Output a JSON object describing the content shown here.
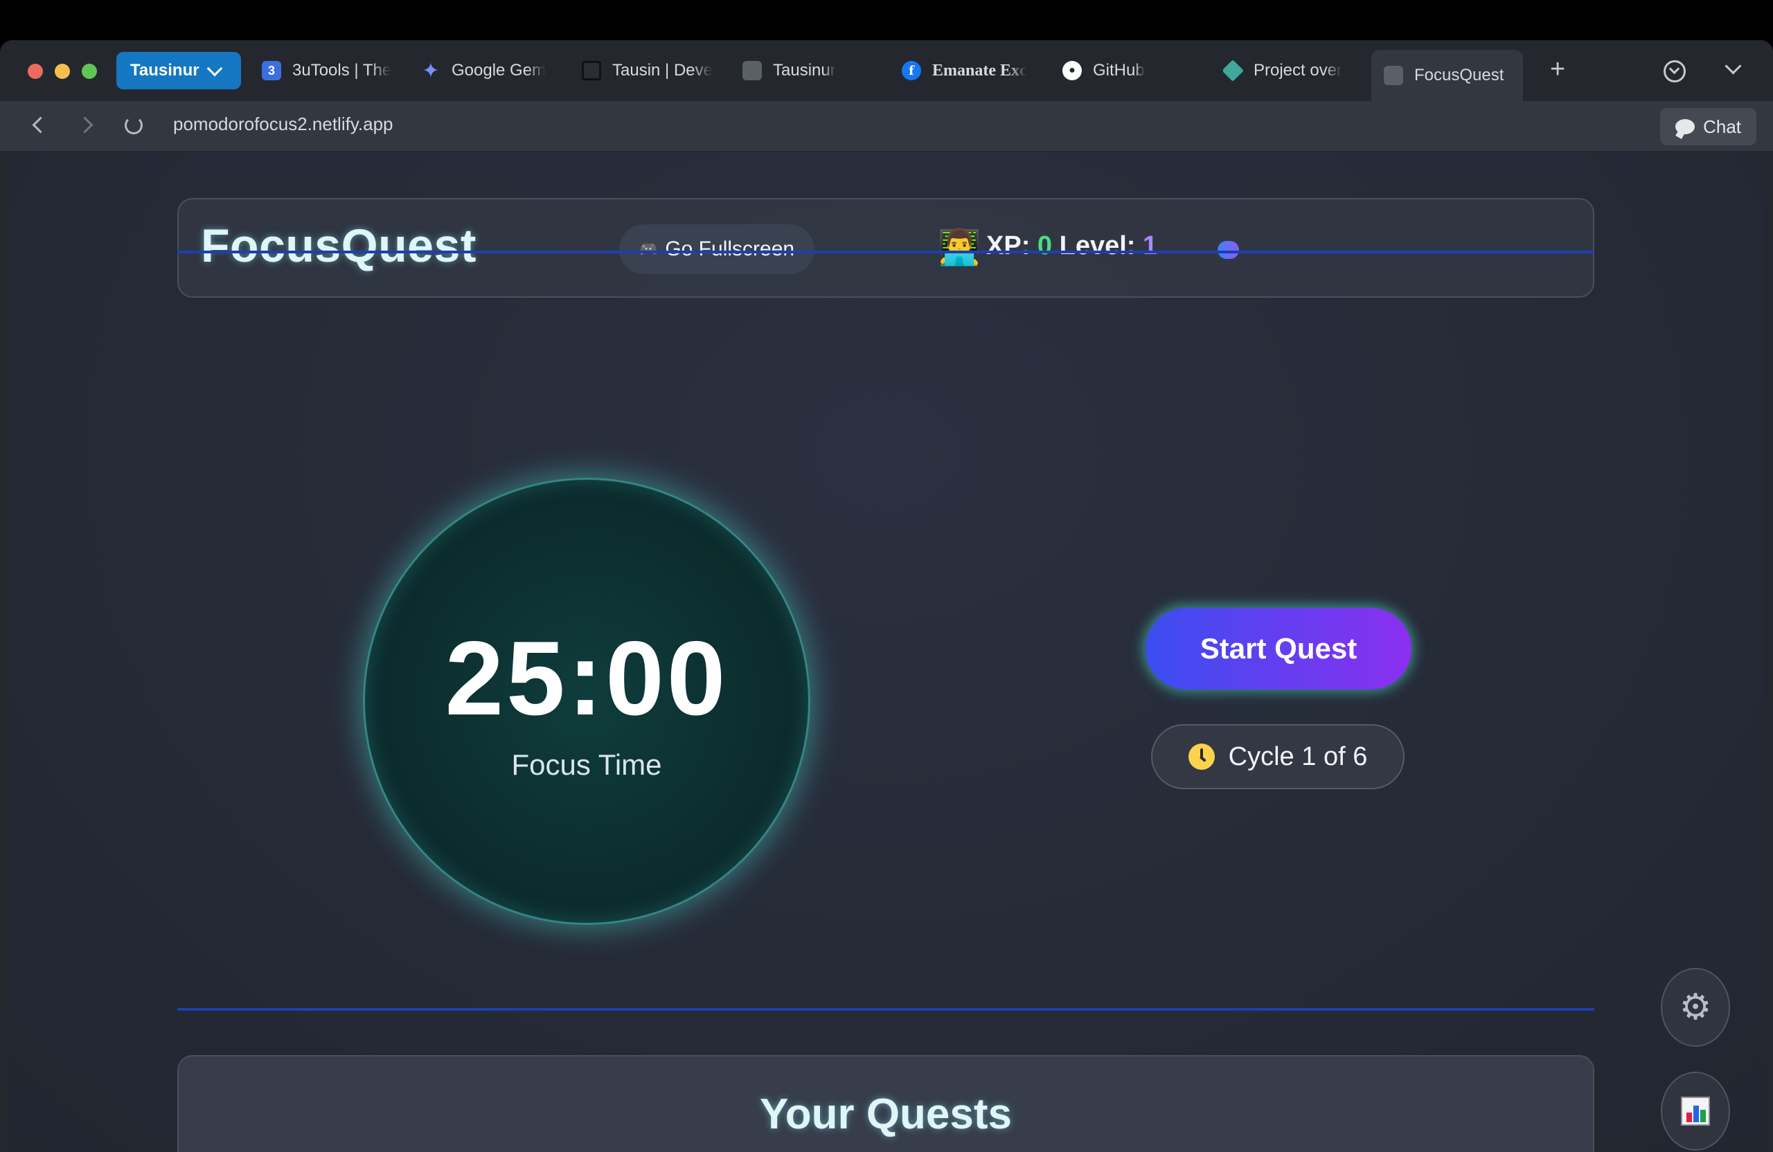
{
  "browser": {
    "profile": "Tausinur",
    "tabs": [
      {
        "title": "3uTools | The",
        "icon": "3utools-icon",
        "color": "#3b6fe0"
      },
      {
        "title": "Google Gem",
        "icon": "gemini-icon",
        "color": "#7f8cff"
      },
      {
        "title": "Tausin | Deve",
        "icon": "chip-icon",
        "color": "#111111"
      },
      {
        "title": "Tausinur",
        "icon": "blank-tab-icon",
        "color": "#5b5f66"
      },
      {
        "title": "Emanate Exc",
        "icon": "facebook-icon",
        "color": "#1877f2"
      },
      {
        "title": "GitHub",
        "icon": "github-icon",
        "color": "#ffffff"
      },
      {
        "title": "Project over",
        "icon": "diamond-icon",
        "color": "#3fa89a"
      },
      {
        "title": "FocusQuest",
        "icon": "blank-tab-icon",
        "color": "#5b5f66",
        "active": true
      }
    ],
    "url": "pomodorofocus2.netlify.app",
    "chat_label": "Chat"
  },
  "header": {
    "brand": "FocusQuest",
    "fullscreen_icon": "🎮",
    "fullscreen_label": "Go Fullscreen",
    "avatar": "👨‍💻",
    "xp_label": "XP:",
    "xp_value": "0",
    "level_label": "Level:",
    "level_value": "1",
    "xp_progress": 0.06
  },
  "timer": {
    "time": "25:00",
    "mode": "Focus Time"
  },
  "controls": {
    "start_label": "Start Quest",
    "cycle_label": "Cycle 1 of 6"
  },
  "quests": {
    "title": "Your Quests"
  },
  "colors": {
    "xp_value": "#4ade80",
    "level_value": "#a78bfa",
    "divider": "#1e3fb0",
    "start_gradient": [
      "#3b4ef0",
      "#8b2ff0"
    ]
  }
}
